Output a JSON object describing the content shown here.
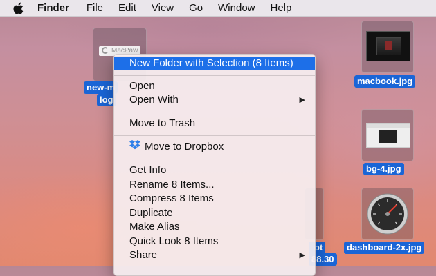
{
  "menubar": {
    "apple_icon": "apple-icon",
    "app_name": "Finder",
    "items": [
      "File",
      "Edit",
      "View",
      "Go",
      "Window",
      "Help"
    ]
  },
  "desktop": {
    "icons": [
      {
        "label_line1": "new-m",
        "label_line2": "log"
      },
      {
        "label": "macbook.jpg"
      },
      {
        "label": "bg-4.jpg"
      },
      {
        "label": "dashboard-2x.jpg"
      },
      {
        "label_partial_1": "ot",
        "label_partial_2": "88.30"
      }
    ],
    "thumb_text": "MacPaw"
  },
  "context_menu": {
    "items": {
      "new_folder": "New Folder with Selection (8 Items)",
      "open": "Open",
      "open_with": "Open With",
      "move_to_trash": "Move to Trash",
      "move_to_dropbox": "Move to Dropbox",
      "get_info": "Get Info",
      "rename": "Rename 8 Items...",
      "compress": "Compress 8 Items",
      "duplicate": "Duplicate",
      "make_alias": "Make Alias",
      "quick_look": "Quick Look 8 Items",
      "share": "Share"
    },
    "submenu_arrow": "▶",
    "highlight_color": "#1d6fe8"
  }
}
